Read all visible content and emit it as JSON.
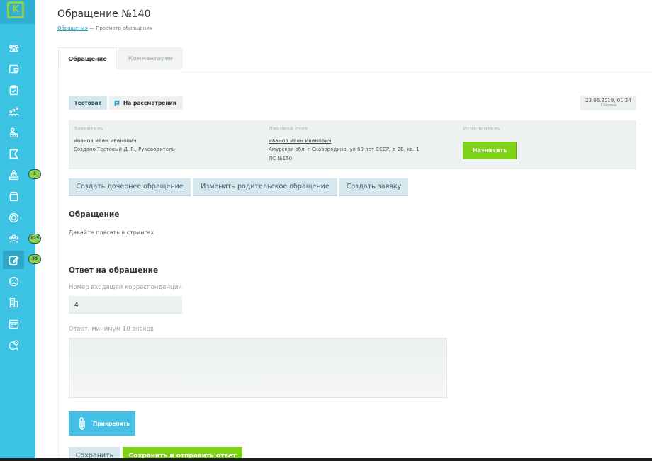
{
  "sidebar": {
    "logo_letter": "K",
    "items": [
      {
        "icon": "phone-icon"
      },
      {
        "icon": "wallet-icon"
      },
      {
        "icon": "clipboard-icon"
      },
      {
        "icon": "chart-users-icon"
      },
      {
        "icon": "building-icon"
      },
      {
        "icon": "logo-flag-icon"
      },
      {
        "icon": "pyramid-icon",
        "badge": "1"
      },
      {
        "icon": "archive-icon"
      },
      {
        "icon": "coin-icon"
      },
      {
        "icon": "team-icon",
        "badge": "125"
      },
      {
        "icon": "edit-icon",
        "badge": "35",
        "active": true
      },
      {
        "icon": "sad-face-icon"
      },
      {
        "icon": "tower-icon"
      },
      {
        "icon": "calendar-icon"
      },
      {
        "icon": "chat-add-icon"
      }
    ]
  },
  "header": {
    "title": "Обращение №140",
    "breadcrumb_link": "Обращения",
    "breadcrumb_current": "— Просмотр обращения"
  },
  "tabs": [
    {
      "label": "Обращение",
      "active": true
    },
    {
      "label": "Комментарии",
      "active": false
    }
  ],
  "status": {
    "type_label": "Тестовая",
    "state_label": "На рассмотрении",
    "date": "23.06.2019, 01:24",
    "date_caption": "Создано"
  },
  "info": {
    "applicant_heading": "Заявитель",
    "applicant_name": "иванов иван иванович",
    "applicant_created": "Создано Тестовый Д. Р., Руководитель",
    "account_heading": "Лицевой счет",
    "account_name": "иванов иван иванович",
    "account_address": "Амурская обл, г Сковородино, ул 60 лет СССР, д 2Б, кв. 1",
    "account_number": "ЛС №150",
    "executor_heading": "Исполнитель",
    "assign_button": "Назначить"
  },
  "actions": {
    "create_child": "Создать дочернее обращение",
    "change_parent": "Изменить родительское обращение",
    "create_request": "Создать заявку"
  },
  "appeal": {
    "title": "Обращение",
    "text": "Давайте плясать в стрингах"
  },
  "answer": {
    "title": "Ответ на обращение",
    "corr_label": "Номер входящей корреспонденции",
    "corr_value": "4",
    "answer_label": "Ответ, минимум 10 знаков",
    "answer_value": "",
    "attach_button": "Прикрепить",
    "save_button": "Сохранить",
    "save_send_button": "Сохранить и отправить ответ"
  },
  "colors": {
    "sidebar": "#3cc3e4",
    "accent_green": "#7fd316",
    "button_light": "#d7e7ee",
    "link": "#2a9bbb"
  }
}
